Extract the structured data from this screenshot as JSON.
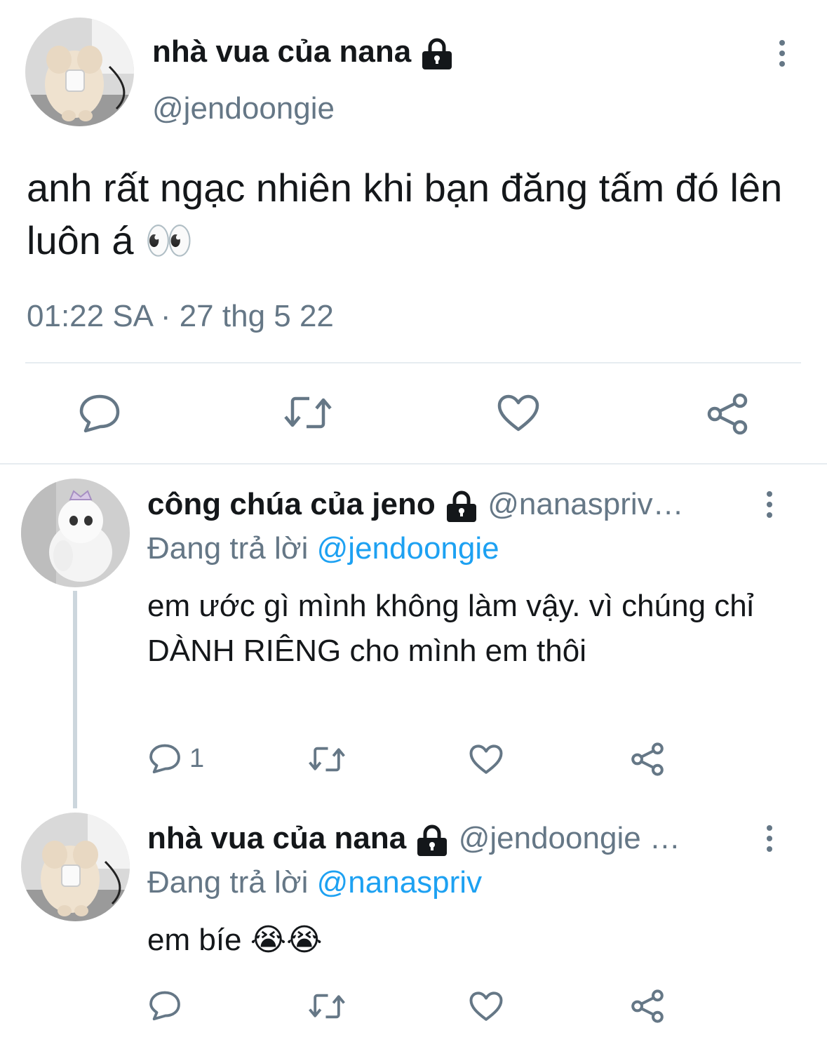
{
  "main_tweet": {
    "display_name": "nhà vua của nana",
    "handle": "@jendoongie",
    "text": "anh rất ngạc nhiên khi bạn đăng tấm đó lên luôn á 👀",
    "timestamp": "01:22 SA · 27 thg 5 22",
    "locked": true
  },
  "replies": [
    {
      "display_name": "công chúa của jeno",
      "handle": "@nanaspriv…",
      "replying_label": "Đang trả lời",
      "replying_to": "@jendoongie",
      "text": "em ước gì mình không làm vậy. vì chúng chỉ DÀNH RIÊNG cho mình em thôi",
      "reply_count": "1",
      "locked": true
    },
    {
      "display_name": "nhà vua của nana",
      "handle": "@jendoongie …",
      "replying_label": "Đang trả lời",
      "replying_to": "@nanaspriv",
      "text": "em bíe 😭😭",
      "reply_count": "",
      "locked": true
    }
  ],
  "icons": [
    "lock-icon",
    "more-options-icon",
    "reply-icon",
    "retweet-icon",
    "like-icon",
    "share-icon"
  ],
  "colors": {
    "text": "#14171a",
    "muted": "#657786",
    "link": "#1da1f2",
    "divider": "#e6ecf0"
  }
}
